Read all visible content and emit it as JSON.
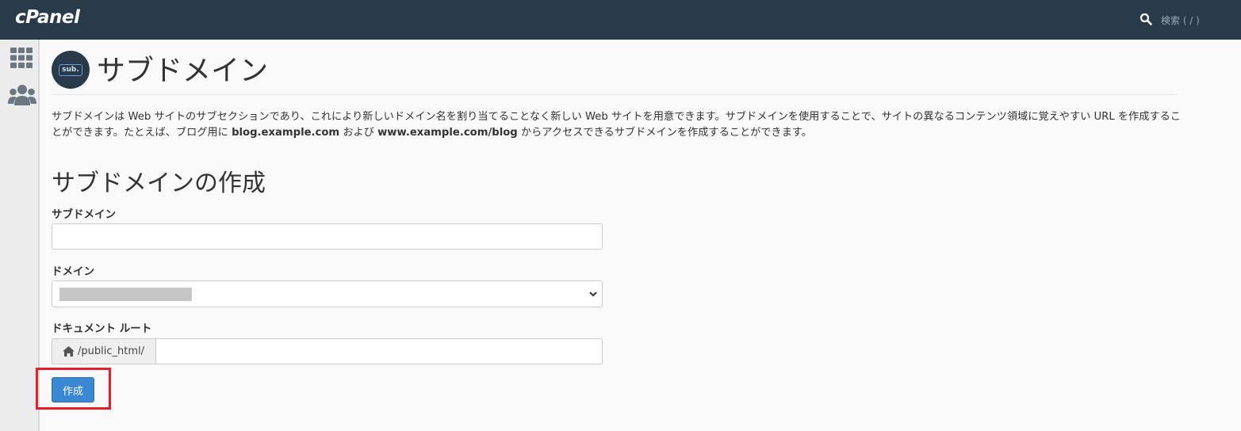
{
  "header": {
    "logo_text": "cPanel",
    "search_placeholder": "検索 ( / )"
  },
  "sidebar": {
    "items": [
      {
        "icon": "grid-icon"
      },
      {
        "icon": "users-icon"
      }
    ]
  },
  "page": {
    "icon_label": "sub.",
    "title": "サブドメイン",
    "description": {
      "part1": "サブドメインは Web サイトのサブセクションであり、これにより新しいドメイン名を割り当てることなく新しい Web サイトを用意できます。サブドメインを使用することで、サイトの異なるコンテンツ領域に覚えやすい URL を作成することができます。たとえば、ブログ用に ",
      "example1": "blog.example.com",
      "part2": " および ",
      "example2": "www.example.com/blog",
      "part3": " からアクセスできるサブドメインを作成することができます。"
    }
  },
  "form": {
    "section_title": "サブドメインの作成",
    "subdomain_label": "サブドメイン",
    "subdomain_value": "",
    "domain_label": "ドメイン",
    "docroot_label": "ドキュメント ルート",
    "docroot_prefix": "/public_html/",
    "docroot_value": "",
    "create_button": "作成"
  },
  "colors": {
    "topbar": "#293a4a",
    "primary_button": "#3a87d3",
    "highlight": "#e0202a"
  }
}
